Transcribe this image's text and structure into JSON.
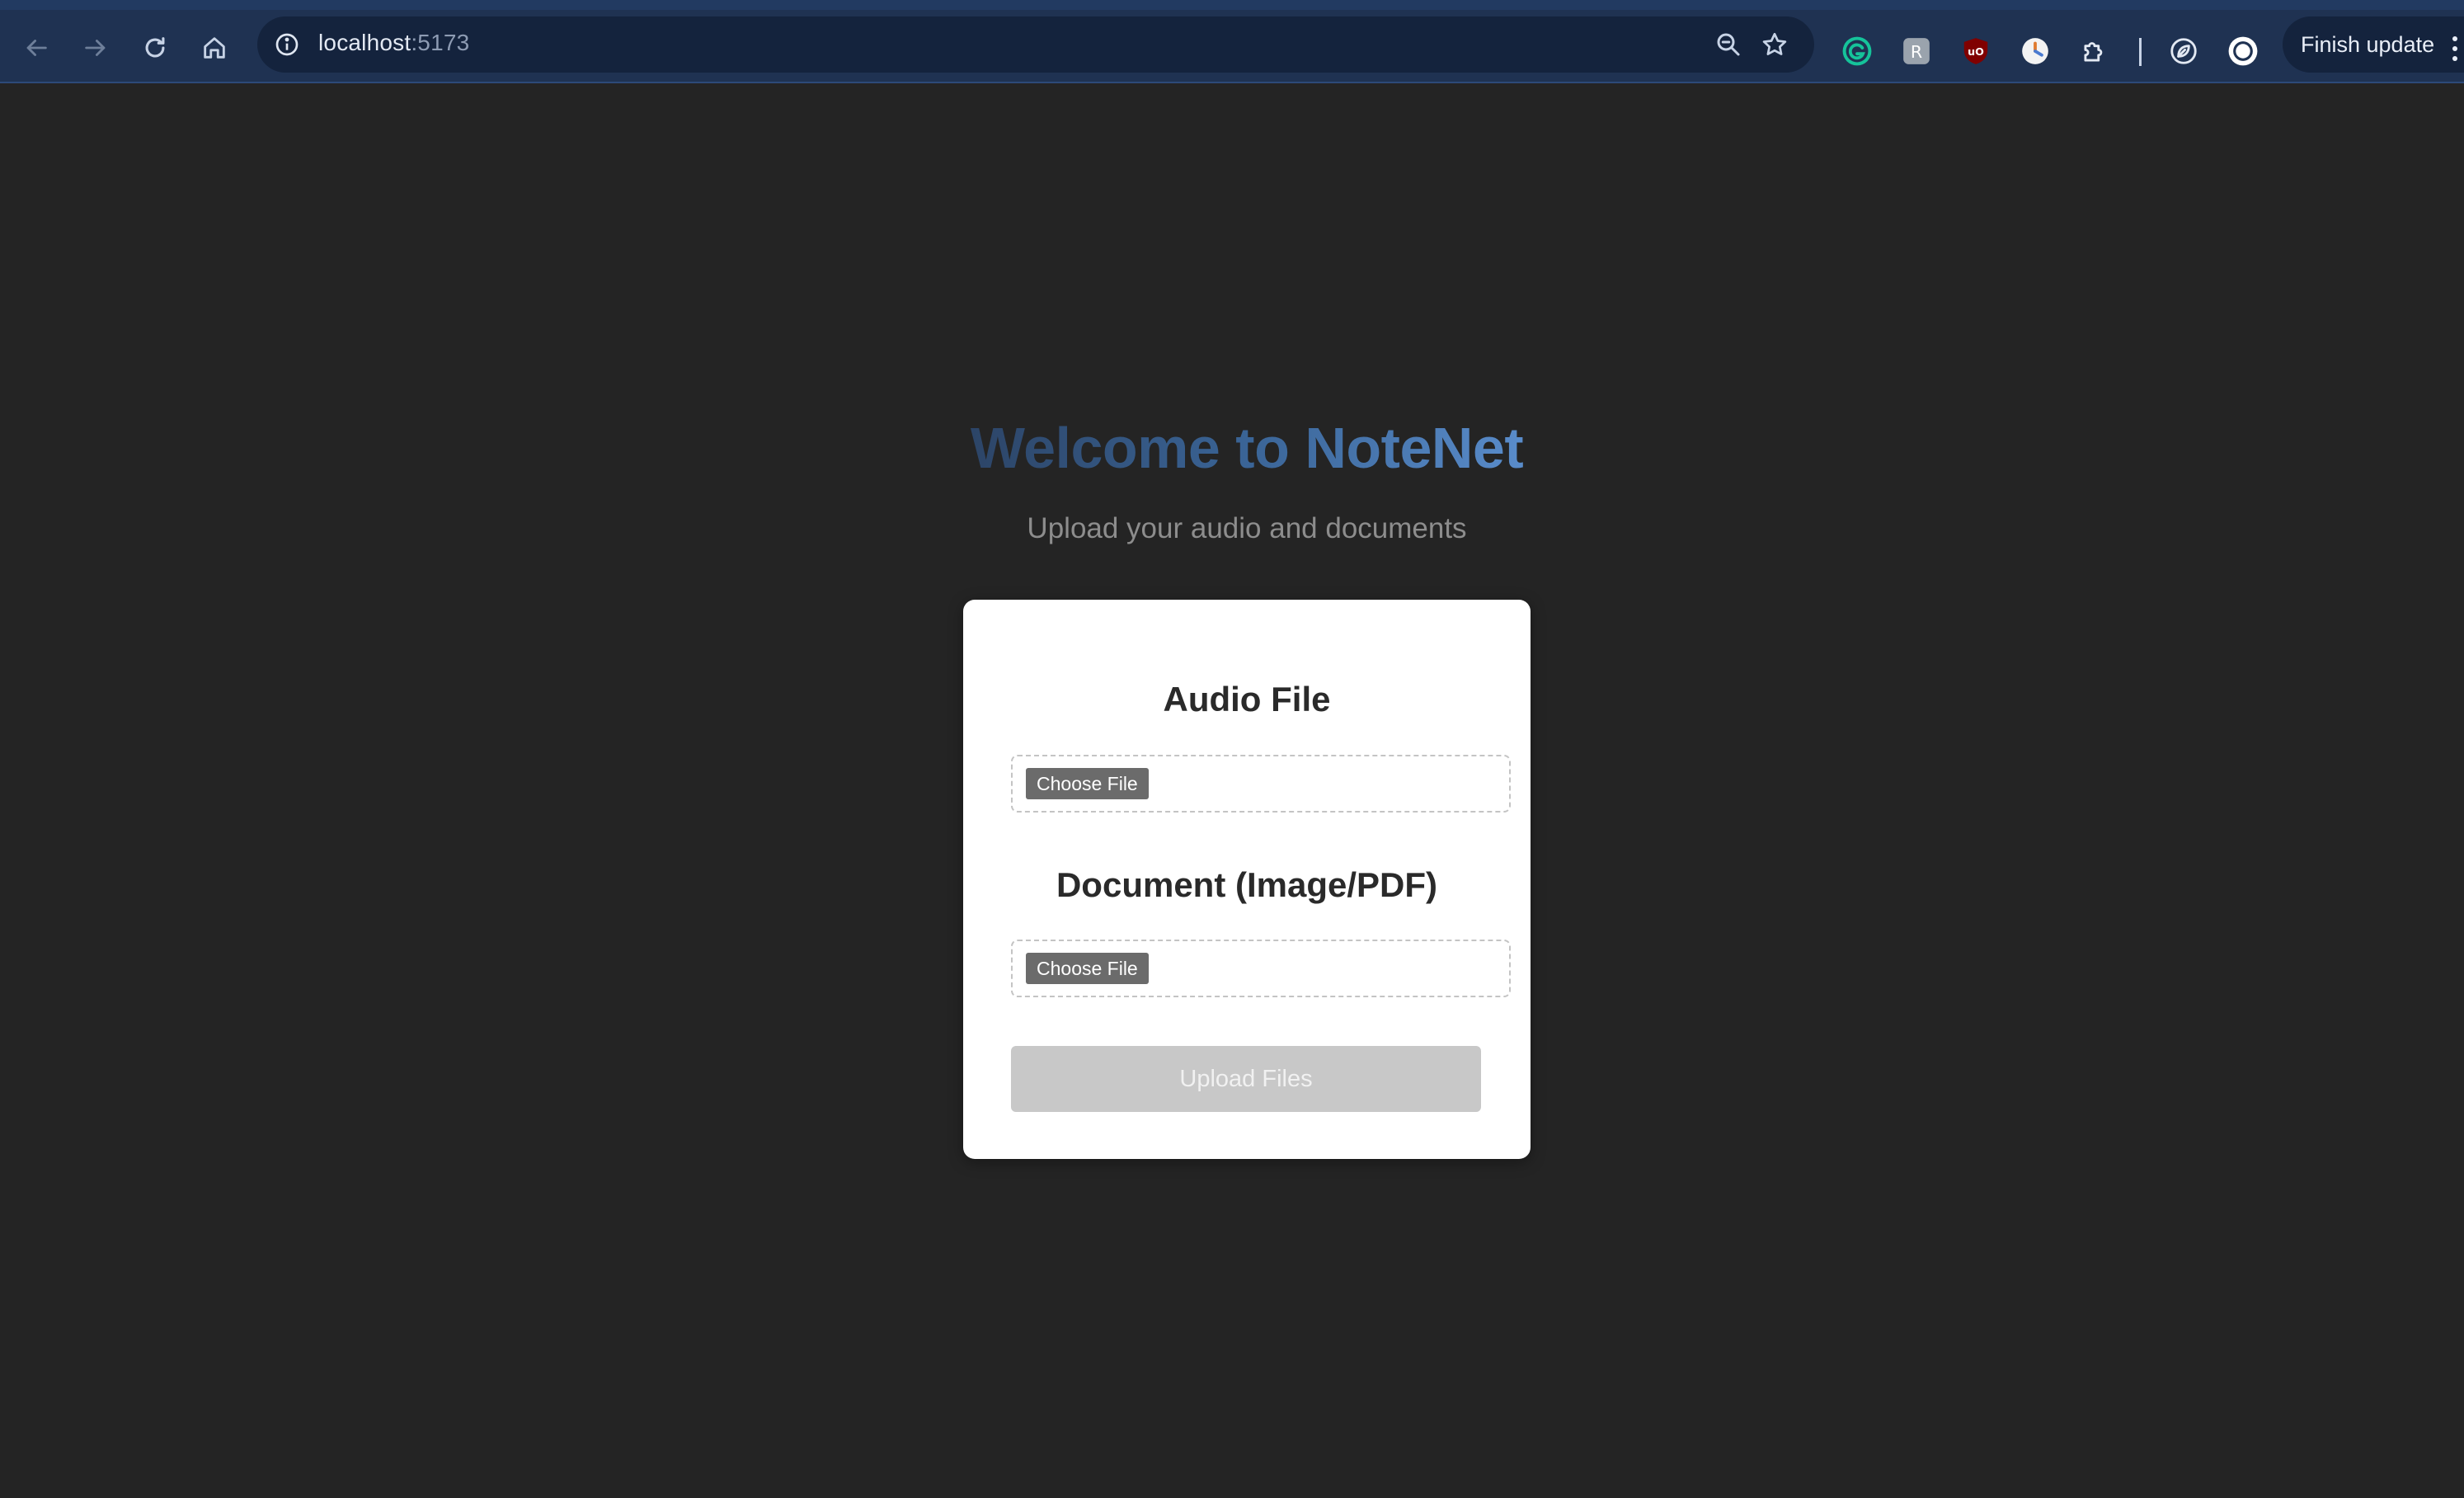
{
  "browser": {
    "url_host": "localhost",
    "url_port": ":5173",
    "finish_update_label": "Finish update",
    "icons": {
      "back": "arrow-left-icon",
      "forward": "arrow-right-icon",
      "reload": "reload-icon",
      "home": "home-icon",
      "site_info": "info-icon",
      "zoom": "zoom-icon",
      "bookmark": "star-icon",
      "extensions": [
        "grammarly-icon",
        "extension-r-icon",
        "ublock-icon",
        "clock-icon",
        "puzzle-icon",
        "leaf-icon",
        "profile-avatar-icon"
      ],
      "menu": "kebab-menu-icon"
    },
    "colors": {
      "toolbar": "#1f3252",
      "omnibox": "#14233d"
    }
  },
  "page": {
    "title": "Welcome to NoteNet",
    "subtitle": "Upload your audio and documents",
    "background": "#242424",
    "form": {
      "audio": {
        "label": "Audio File",
        "button_label": "Choose File"
      },
      "document": {
        "label": "Document (Image/PDF)",
        "button_label": "Choose File"
      },
      "submit_label": "Upload Files",
      "submit_disabled": true
    }
  }
}
